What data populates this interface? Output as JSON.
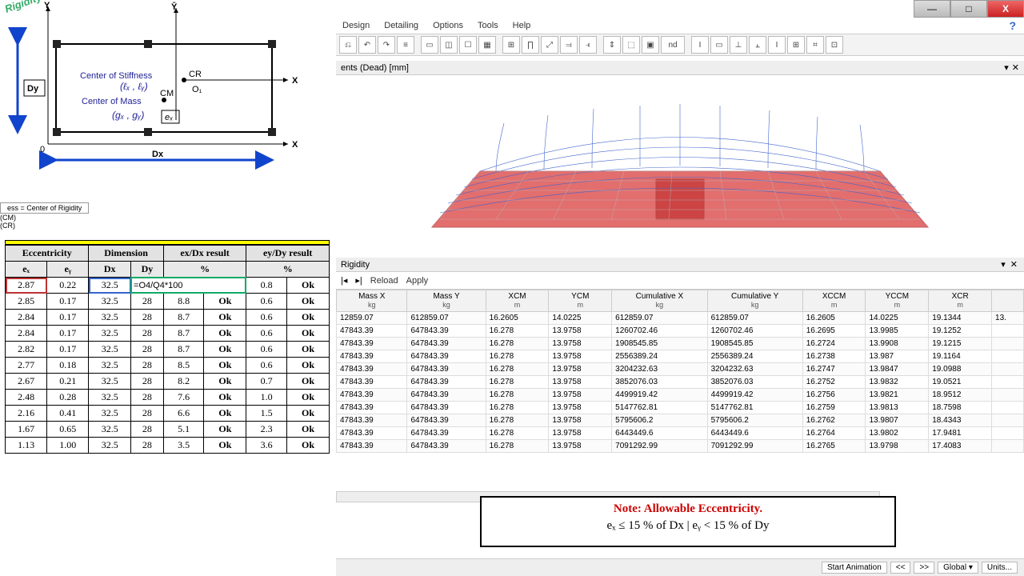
{
  "window": {
    "close": "X"
  },
  "menu": {
    "items": [
      "Design",
      "Detailing",
      "Options",
      "Tools",
      "Help"
    ]
  },
  "viewport_title": "ents (Dead)  [mm]",
  "diagram": {
    "title_corner": "Rigidity",
    "stiff_label": "Center of Stiffness",
    "stiff_sym": "(ℓₓ , ℓᵧ)",
    "mass_label": "Center of Mass",
    "mass_sym": "(gₓ , gᵧ)",
    "cr": "CR",
    "cm": "CM",
    "ox": "O₁",
    "dy": "Dy",
    "dx": "Dx",
    "ex": "eₓ",
    "y": "Y",
    "ybar": "Ȳ",
    "x": "X",
    "zero": "0"
  },
  "caption": {
    "text": "ess = Center of Rigidity",
    "sub1": "(CM)",
    "sub2": "(CR)"
  },
  "spread": {
    "groups": {
      "ecc": "Eccentricity",
      "dim": "Dimension",
      "r1": "ex/Dx result",
      "r2": "ey/Dy result"
    },
    "heads": {
      "ex": "eₓ",
      "ey": "eᵧ",
      "dx": "Dx",
      "dy": "Dy",
      "pct": "%"
    },
    "formula": "=O4/Q4*100",
    "rows": [
      {
        "ex": "2.87",
        "ey": "0.22",
        "dx": "32.5",
        "dy": "",
        "p1": "",
        "ok1": "",
        "p2": "0.8",
        "ok2": "Ok"
      },
      {
        "ex": "2.85",
        "ey": "0.17",
        "dx": "32.5",
        "dy": "28",
        "p1": "8.8",
        "ok1": "Ok",
        "p2": "0.6",
        "ok2": "Ok"
      },
      {
        "ex": "2.84",
        "ey": "0.17",
        "dx": "32.5",
        "dy": "28",
        "p1": "8.7",
        "ok1": "Ok",
        "p2": "0.6",
        "ok2": "Ok"
      },
      {
        "ex": "2.84",
        "ey": "0.17",
        "dx": "32.5",
        "dy": "28",
        "p1": "8.7",
        "ok1": "Ok",
        "p2": "0.6",
        "ok2": "Ok"
      },
      {
        "ex": "2.82",
        "ey": "0.17",
        "dx": "32.5",
        "dy": "28",
        "p1": "8.7",
        "ok1": "Ok",
        "p2": "0.6",
        "ok2": "Ok"
      },
      {
        "ex": "2.77",
        "ey": "0.18",
        "dx": "32.5",
        "dy": "28",
        "p1": "8.5",
        "ok1": "Ok",
        "p2": "0.6",
        "ok2": "Ok"
      },
      {
        "ex": "2.67",
        "ey": "0.21",
        "dx": "32.5",
        "dy": "28",
        "p1": "8.2",
        "ok1": "Ok",
        "p2": "0.7",
        "ok2": "Ok"
      },
      {
        "ex": "2.48",
        "ey": "0.28",
        "dx": "32.5",
        "dy": "28",
        "p1": "7.6",
        "ok1": "Ok",
        "p2": "1.0",
        "ok2": "Ok"
      },
      {
        "ex": "2.16",
        "ey": "0.41",
        "dx": "32.5",
        "dy": "28",
        "p1": "6.6",
        "ok1": "Ok",
        "p2": "1.5",
        "ok2": "Ok"
      },
      {
        "ex": "1.67",
        "ey": "0.65",
        "dx": "32.5",
        "dy": "28",
        "p1": "5.1",
        "ok1": "Ok",
        "p2": "2.3",
        "ok2": "Ok"
      },
      {
        "ex": "1.13",
        "ey": "1.00",
        "dx": "32.5",
        "dy": "28",
        "p1": "3.5",
        "ok1": "Ok",
        "p2": "3.6",
        "ok2": "Ok"
      }
    ]
  },
  "rig": {
    "title": "Rigidity",
    "reload": "Reload",
    "apply": "Apply",
    "cols": [
      {
        "h": "Mass X",
        "u": "kg"
      },
      {
        "h": "Mass Y",
        "u": "kg"
      },
      {
        "h": "XCM",
        "u": "m"
      },
      {
        "h": "YCM",
        "u": "m"
      },
      {
        "h": "Cumulative X",
        "u": "kg"
      },
      {
        "h": "Cumulative Y",
        "u": "kg"
      },
      {
        "h": "XCCM",
        "u": "m"
      },
      {
        "h": "YCCM",
        "u": "m"
      },
      {
        "h": "XCR",
        "u": "m"
      },
      {
        "h": "",
        "u": ""
      }
    ],
    "rows": [
      [
        "12859.07",
        "612859.07",
        "16.2605",
        "14.0225",
        "612859.07",
        "612859.07",
        "16.2605",
        "14.0225",
        "19.1344",
        "13."
      ],
      [
        "47843.39",
        "647843.39",
        "16.278",
        "13.9758",
        "1260702.46",
        "1260702.46",
        "16.2695",
        "13.9985",
        "19.1252",
        ""
      ],
      [
        "47843.39",
        "647843.39",
        "16.278",
        "13.9758",
        "1908545.85",
        "1908545.85",
        "16.2724",
        "13.9908",
        "19.1215",
        ""
      ],
      [
        "47843.39",
        "647843.39",
        "16.278",
        "13.9758",
        "2556389.24",
        "2556389.24",
        "16.2738",
        "13.987",
        "19.1164",
        ""
      ],
      [
        "47843.39",
        "647843.39",
        "16.278",
        "13.9758",
        "3204232.63",
        "3204232.63",
        "16.2747",
        "13.9847",
        "19.0988",
        ""
      ],
      [
        "47843.39",
        "647843.39",
        "16.278",
        "13.9758",
        "3852076.03",
        "3852076.03",
        "16.2752",
        "13.9832",
        "19.0521",
        ""
      ],
      [
        "47843.39",
        "647843.39",
        "16.278",
        "13.9758",
        "4499919.42",
        "4499919.42",
        "16.2756",
        "13.9821",
        "18.9512",
        ""
      ],
      [
        "47843.39",
        "647843.39",
        "16.278",
        "13.9758",
        "5147762.81",
        "5147762.81",
        "16.2759",
        "13.9813",
        "18.7598",
        ""
      ],
      [
        "47843.39",
        "647843.39",
        "16.278",
        "13.9758",
        "5795606.2",
        "5795606.2",
        "16.2762",
        "13.9807",
        "18.4343",
        ""
      ],
      [
        "47843.39",
        "647843.39",
        "16.278",
        "13.9758",
        "6443449.6",
        "6443449.6",
        "16.2764",
        "13.9802",
        "17.9481",
        ""
      ],
      [
        "47843.39",
        "647843.39",
        "16.278",
        "13.9758",
        "7091292.99",
        "7091292.99",
        "16.2765",
        "13.9798",
        "17.4083",
        ""
      ]
    ]
  },
  "note": {
    "red": "Note: Allowable Eccentricity.",
    "line": "eₓ ≤ 15 % of Dx   |   eᵧ < 15 % of Dy"
  },
  "status": {
    "start": "Start Animation",
    "prev": "<<",
    "next": ">>",
    "global": "Global",
    "units": "Units..."
  }
}
